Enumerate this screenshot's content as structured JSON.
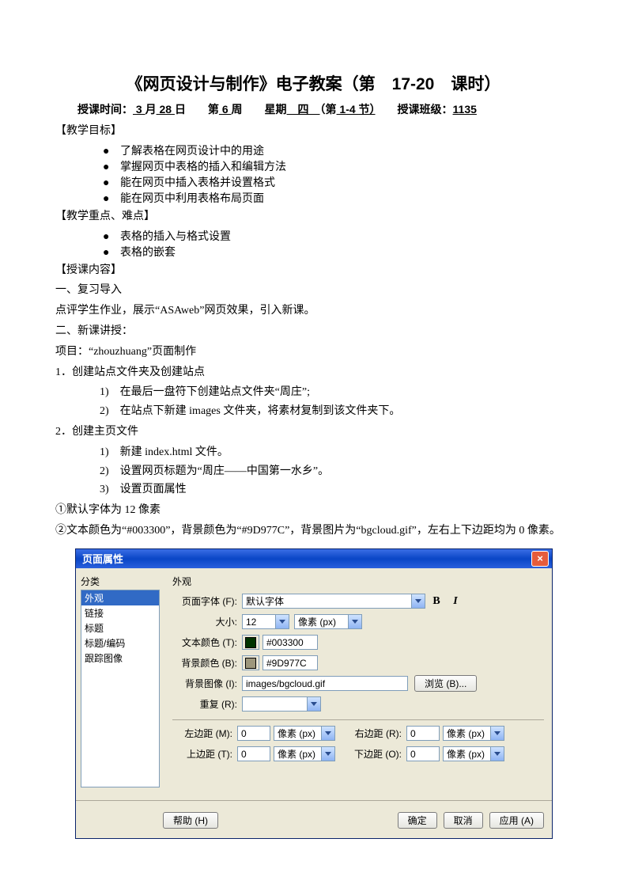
{
  "doc": {
    "title": "《网页设计与制作》电子教案（第　17-20　课时）",
    "meta_parts": {
      "a": "授课时间：",
      "month": "  3  ",
      "b": "月",
      "day": "  28  ",
      "c": "日　　第",
      "week": "  6  ",
      "d": "周　　星期",
      "dow": "　四　",
      "e": "（第",
      "periods": " 1-4 ",
      "f": "节）",
      "g": "　　授课班级：",
      "class": "1135"
    },
    "sections": {
      "goals_h": "【教学目标】",
      "goals": [
        "了解表格在网页设计中的用途",
        "掌握网页中表格的插入和编辑方法",
        "能在网页中插入表格并设置格式",
        "能在网页中利用表格布局页面"
      ],
      "focus_h": "【教学重点、难点】",
      "focus": [
        "表格的插入与格式设置",
        "表格的嵌套"
      ],
      "content_h": "【授课内容】",
      "p1_h": "一、复习导入",
      "p1": "点评学生作业，展示“ASAweb”网页效果，引入新课。",
      "p2_h": "二、新课讲授：",
      "proj": "项目：“zhouzhuang”页面制作",
      "s1": "1．创建站点文件夹及创建站点",
      "s1_1": "1)　在最后一盘符下创建站点文件夹“周庄”;",
      "s1_2": "2)　在站点下新建 images 文件夹，将素材复制到该文件夹下。",
      "s2": "2．创建主页文件",
      "s2_1": "1)　新建 index.html 文件。",
      "s2_2": "2)　设置网页标题为“周庄——中国第一水乡”。",
      "s2_3": "3)　设置页面属性",
      "pA": "①默认字体为 12 像素",
      "pB": "②文本颜色为“#003300”，背景颜色为“#9D977C”，背景图片为“bgcloud.gif”，左右上下边距均为 0 像素。"
    }
  },
  "dialog": {
    "title": "页面属性",
    "cat_label": "分类",
    "cats": [
      "外观",
      "链接",
      "标题",
      "标题/编码",
      "跟踪图像"
    ],
    "panel_label": "外观",
    "labels": {
      "font": "页面字体 (F):",
      "size": "大小:",
      "pxunit": "像素 (px)",
      "textcolor": "文本颜色 (T):",
      "bgcolor": "背景颜色 (B):",
      "bgimg": "背景图像 (I):",
      "browse": "浏览 (B)...",
      "repeat": "重复 (R):",
      "ml": "左边距 (M):",
      "mr": "右边距 (R):",
      "mt": "上边距 (T):",
      "mb": "下边距 (O):"
    },
    "values": {
      "font": "默认字体",
      "size": "12",
      "textcolor_hex": "#003300",
      "bgcolor_hex": "#9D977C",
      "bgimg": "images/bgcloud.gif",
      "repeat": "",
      "ml": "0",
      "mr": "0",
      "mt": "0",
      "mb": "0"
    },
    "buttons": {
      "help": "帮助 (H)",
      "ok": "确定",
      "cancel": "取消",
      "apply": "应用 (A)"
    }
  }
}
